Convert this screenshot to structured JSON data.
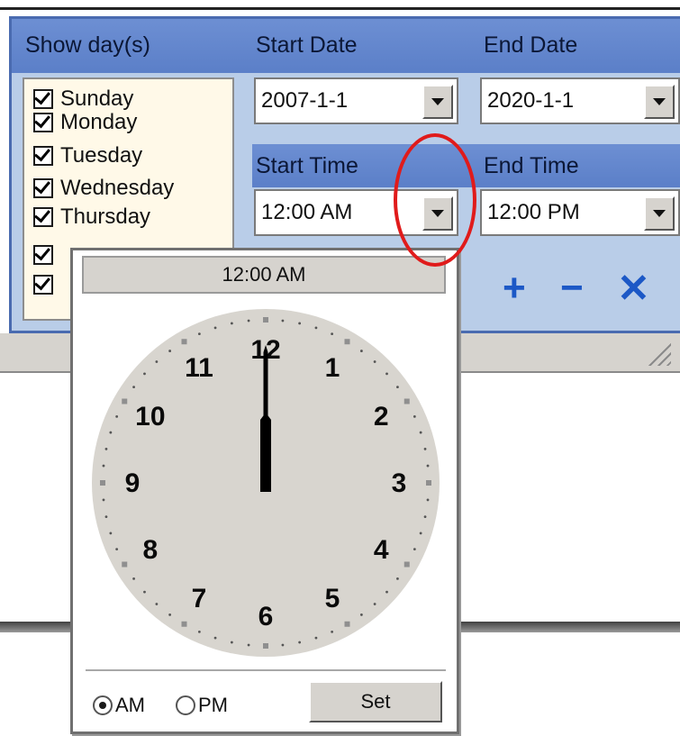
{
  "headers": {
    "show_days": "Show day(s)",
    "start_date": "Start Date",
    "end_date": "End Date",
    "start_time": "Start Time",
    "end_time": "End Time"
  },
  "days": [
    {
      "label": "Sunday",
      "checked": true
    },
    {
      "label": "Monday",
      "checked": true
    },
    {
      "label": "Tuesday",
      "checked": true
    },
    {
      "label": "Wednesday",
      "checked": true
    },
    {
      "label": "Thursday",
      "checked": true
    },
    {
      "label": "",
      "checked": true
    },
    {
      "label": "",
      "checked": true
    }
  ],
  "start_date_value": "2007-1-1",
  "end_date_value": "2020-1-1",
  "start_time_value": "12:00 AM",
  "end_time_value": "12:00 PM",
  "actions": {
    "add": "+",
    "remove": "−",
    "delete": "✕"
  },
  "popup": {
    "title": "12:00 AM",
    "clock_numbers": [
      "12",
      "1",
      "2",
      "3",
      "4",
      "5",
      "6",
      "7",
      "8",
      "9",
      "10",
      "11"
    ],
    "time": {
      "hour": 12,
      "minute": 0
    },
    "am_label": "AM",
    "pm_label": "PM",
    "am_selected": true,
    "set_label": "Set"
  },
  "colors": {
    "accent": "#1c58c6",
    "highlight": "#e01b1b",
    "panel": "#b9cde8"
  }
}
